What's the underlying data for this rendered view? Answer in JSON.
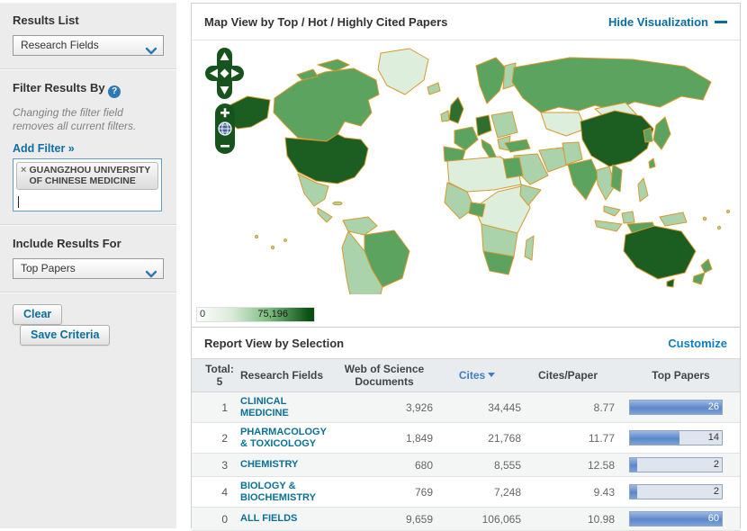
{
  "sidebar": {
    "results_list_label": "Results List",
    "results_list_value": "Research Fields",
    "filter_by_label": "Filter Results By",
    "help_glyph": "?",
    "filter_note": "Changing the filter field removes all current filters.",
    "add_filter_label": "Add Filter »",
    "filter_chip_remove": "×",
    "filter_chip": "GUANGZHOU UNIVERSITY OF CHINESE MEDICINE",
    "include_label": "Include Results For",
    "include_value": "Top Papers",
    "clear_button": "Clear",
    "save_button": "Save Criteria"
  },
  "map": {
    "title": "Map View by Top / Hot / Highly Cited Papers",
    "hide_label": "Hide Visualization",
    "legend": {
      "min": "0",
      "max": "75,196"
    },
    "controls": {
      "zoom_in": "+",
      "zoom_out": "−"
    },
    "palette": {
      "darkest": "#1c5e22",
      "dark": "#2e6e2f",
      "medium": "#5ba35f",
      "light": "#abd3ab",
      "vlight": "#ddeedd",
      "border": "#d49a2e",
      "control": "#17541d"
    }
  },
  "report": {
    "title": "Report View by Selection",
    "customize_label": "Customize"
  },
  "table": {
    "headers": {
      "total_line1": "Total:",
      "total_line2": "5",
      "fields": "Research Fields",
      "documents_line1": "Web of Science",
      "documents_line2": "Documents",
      "cites": "Cites",
      "cites_per_paper": "Cites/Paper",
      "top_papers": "Top Papers"
    },
    "sort": {
      "column": "Cites",
      "direction": "desc"
    },
    "rows": [
      {
        "rank": "1",
        "field": "CLINICAL MEDICINE",
        "documents": "3,926",
        "cites": "34,445",
        "cites_per_paper": "8.77",
        "top_papers": "26",
        "bar_pct": 100
      },
      {
        "rank": "2",
        "field": "PHARMACOLOGY & TOXICOLOGY",
        "documents": "1,849",
        "cites": "21,768",
        "cites_per_paper": "11.77",
        "top_papers": "14",
        "bar_pct": 54
      },
      {
        "rank": "3",
        "field": "CHEMISTRY",
        "documents": "680",
        "cites": "8,555",
        "cites_per_paper": "12.58",
        "top_papers": "2",
        "bar_pct": 8
      },
      {
        "rank": "4",
        "field": "BIOLOGY & BIOCHEMISTRY",
        "documents": "769",
        "cites": "7,248",
        "cites_per_paper": "9.43",
        "top_papers": "2",
        "bar_pct": 8
      },
      {
        "rank": "0",
        "field": "ALL FIELDS",
        "documents": "9,659",
        "cites": "106,065",
        "cites_per_paper": "10.98",
        "top_papers": "60",
        "bar_pct": 100
      }
    ]
  }
}
